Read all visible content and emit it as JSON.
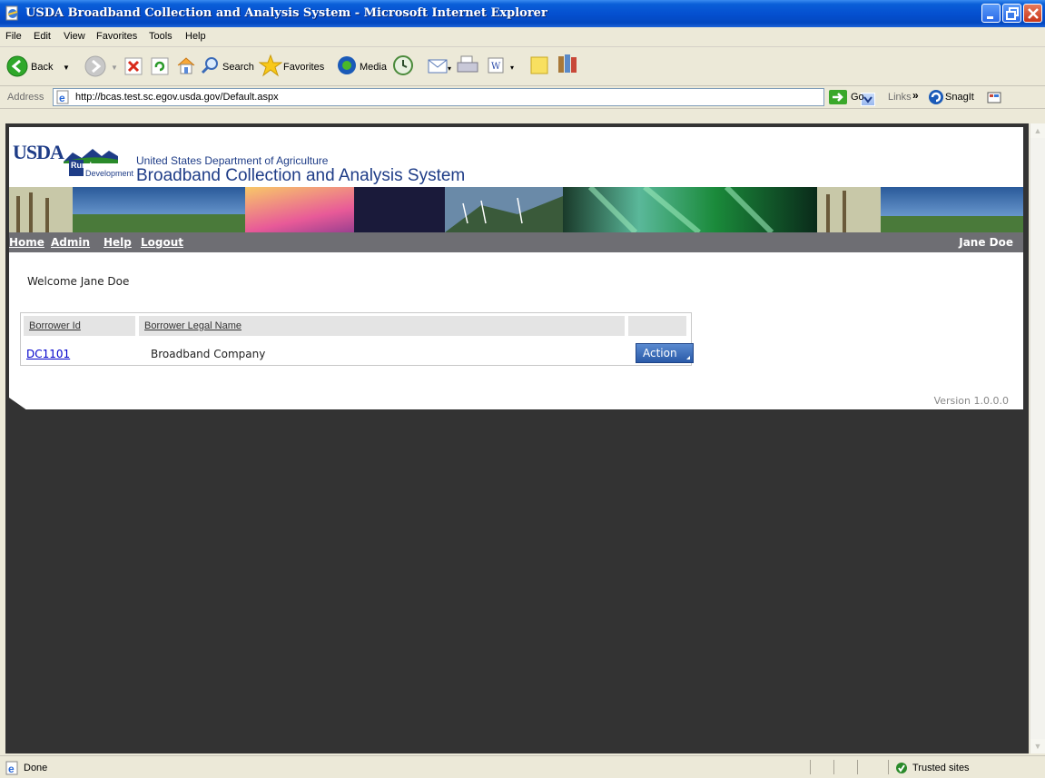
{
  "window": {
    "title": "USDA Broadband Collection and Analysis System - Microsoft Internet Explorer"
  },
  "menu": [
    "File",
    "Edit",
    "View",
    "Favorites",
    "Tools",
    "Help"
  ],
  "toolbar": {
    "back_label": "Back",
    "search_label": "Search",
    "favorites_label": "Favorites",
    "media_label": "Media"
  },
  "address": {
    "label": "Address",
    "url": "http://bcas.test.sc.egov.usda.gov/Default.aspx",
    "go_label": "Go",
    "links_label": "Links",
    "snagit_label": "SnagIt"
  },
  "header": {
    "logo_text": "USDA",
    "logo_sub": "Rural\nDevelopment",
    "department": "United States Department of Agriculture",
    "system_name": "Broadband Collection and Analysis System"
  },
  "nav": {
    "links": [
      "Home",
      "Admin",
      "Help",
      "Logout"
    ],
    "user": "Jane Doe"
  },
  "main": {
    "welcome": "Welcome Jane Doe",
    "grid": {
      "headers": [
        "Borrower Id",
        "Borrower Legal Name",
        ""
      ],
      "rows": [
        {
          "id": "DC1101",
          "name": "Broadband Company",
          "action": "Action"
        }
      ]
    },
    "version": "Version 1.0.0.0"
  },
  "status": {
    "text": "Done",
    "zone": "Trusted sites"
  },
  "colors": {
    "titlebar": "#0550d0",
    "usda_blue": "#1e3c87",
    "nav_gray": "#6e6e73",
    "background": "#333333",
    "link": "#0000cc"
  }
}
